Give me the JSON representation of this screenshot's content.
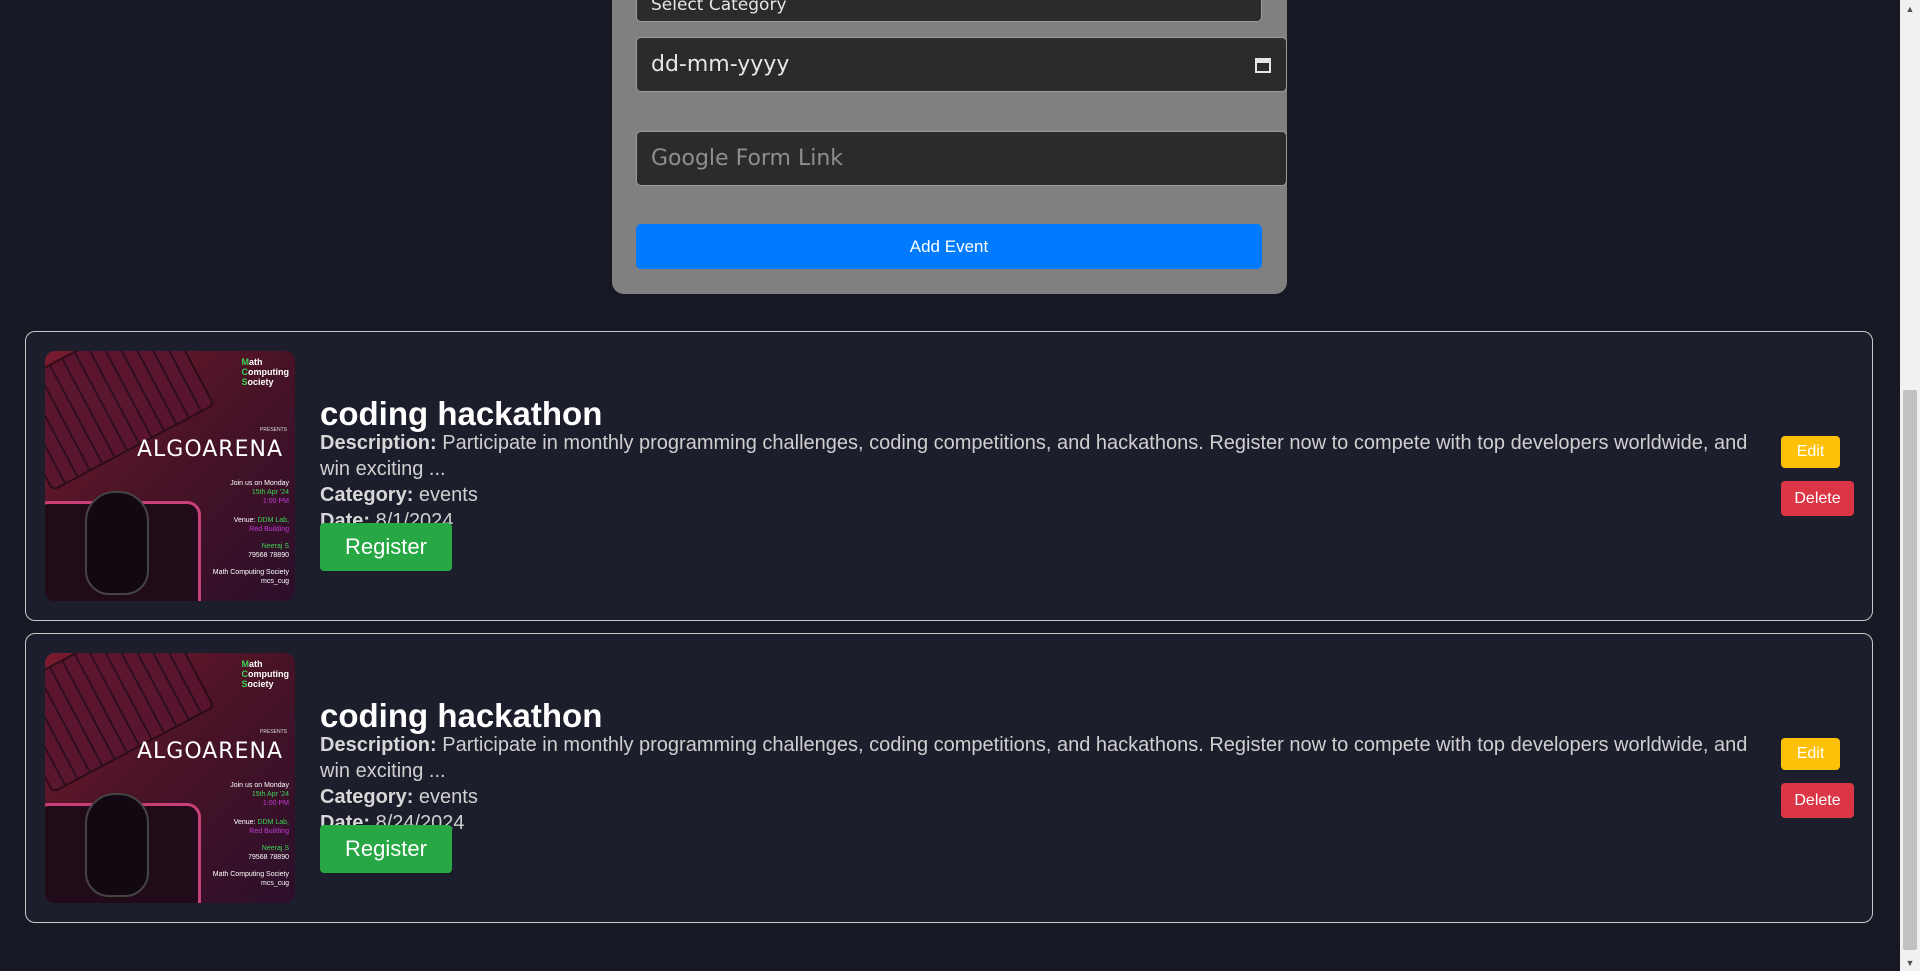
{
  "form": {
    "category_select": "Select Category",
    "date_placeholder": "dd-mm-yyyy",
    "link_placeholder": "Google Form Link",
    "add_button": "Add Event"
  },
  "events": [
    {
      "title": "coding hackathon",
      "description_label": "Description:",
      "description": "Participate in monthly programming challenges, coding competitions, and hackathons. Register now to compete with top developers worldwide, and win exciting ...",
      "category_label": "Category:",
      "category": "events",
      "date_label": "Date:",
      "date": "8/1/2024",
      "register": "Register",
      "edit": "Edit",
      "delete": "Delete"
    },
    {
      "title": "coding hackathon",
      "description_label": "Description:",
      "description": "Participate in monthly programming challenges, coding competitions, and hackathons. Register now to compete with top developers worldwide, and win exciting ...",
      "category_label": "Category:",
      "category": "events",
      "date_label": "Date:",
      "date": "8/24/2024",
      "register": "Register",
      "edit": "Edit",
      "delete": "Delete"
    }
  ],
  "poster": {
    "brand_m": "M",
    "brand_math": "ath",
    "brand_c": "C",
    "brand_computing": "omputing",
    "brand_s": "S",
    "brand_society": "ociety",
    "presents": "PRESENTS",
    "title": "ALGOARENA",
    "join": "Join us on Monday",
    "date": "15th Apr '24",
    "time": "1:00 PM",
    "venue_label": "Venue:",
    "venue": "DDM Lab,",
    "building": "Red Building",
    "contact_name": "Neeraj S",
    "contact_phone": "79568 78890",
    "footer_1": "Math Computing Society",
    "footer_2": "mcs_cug"
  },
  "colors": {
    "background": "#161824",
    "card": "#1d1e2c",
    "panel": "#808080",
    "add": "#007bff",
    "register": "#28a745",
    "edit": "#ffc107",
    "delete": "#dc3545"
  }
}
